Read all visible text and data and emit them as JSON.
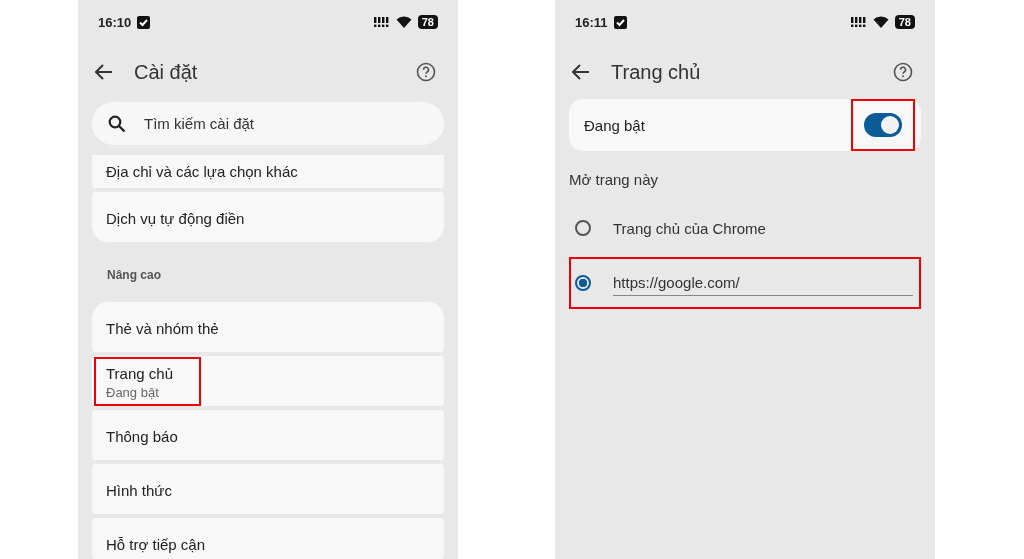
{
  "screens": [
    {
      "kind": "settings",
      "status_bar": {
        "time": "16:10",
        "battery": "78"
      },
      "header": {
        "title": "Cài đặt"
      },
      "search": {
        "placeholder": "Tìm kiếm cài đặt"
      },
      "groups": [
        {
          "items": [
            {
              "title": "Địa chỉ và các lựa chọn khác",
              "highlighted": false
            },
            {
              "title": "Dịch vụ tự động điền",
              "highlighted": false
            }
          ]
        },
        {
          "heading": "Nâng cao",
          "items": [
            {
              "title": "Thẻ và nhóm thẻ",
              "highlighted": false
            },
            {
              "title": "Trang chủ",
              "subtitle": "Đang bật",
              "highlighted": true
            },
            {
              "title": "Thông báo",
              "highlighted": false
            },
            {
              "title": "Hình thức",
              "highlighted": false
            },
            {
              "title": "Hỗ trợ tiếp cận",
              "highlighted": false
            }
          ]
        }
      ]
    },
    {
      "kind": "homepage",
      "status_bar": {
        "time": "16:11",
        "battery": "78"
      },
      "header": {
        "title": "Trang chủ"
      },
      "toggle": {
        "label": "Đang bật",
        "on": true,
        "highlighted": true
      },
      "section": "Mở trang này",
      "options": [
        {
          "kind": "label",
          "label": "Trang chủ của Chrome",
          "selected": false,
          "highlighted": false
        },
        {
          "kind": "url",
          "value": "https://google.com/",
          "selected": true,
          "highlighted": true
        }
      ]
    }
  ]
}
